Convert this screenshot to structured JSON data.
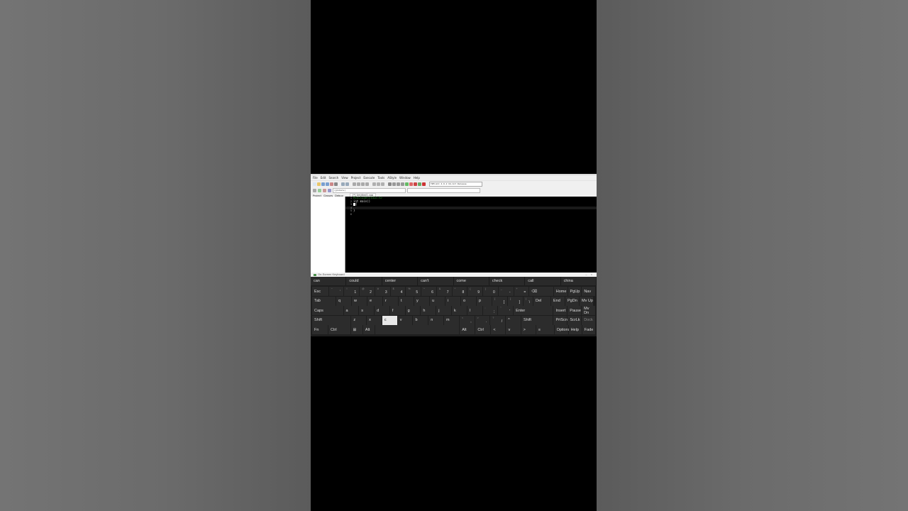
{
  "ide": {
    "menu": [
      "File",
      "Edit",
      "Search",
      "View",
      "Project",
      "Execute",
      "Tools",
      "AStyle",
      "Window",
      "Help"
    ],
    "compiler_combo": "TDM-GCC 4.9.2 64-bit Release",
    "scope_combo": "(globals)",
    "left_tabs": [
      "Project",
      "Classes",
      "Debug"
    ],
    "file_tab": "[*] Untitled1.cpp",
    "code_lines": [
      {
        "n": "1",
        "text": "#include<stdio.h>",
        "style": "comment"
      },
      {
        "n": "2",
        "text": "int main()",
        "style": "code"
      },
      {
        "n": "3",
        "text": "{",
        "style": "code"
      },
      {
        "n": "4",
        "text": "",
        "style": "code"
      },
      {
        "n": "5",
        "text": "}",
        "style": "code"
      },
      {
        "n": "6",
        "text": "",
        "style": "code"
      }
    ]
  },
  "keyboard": {
    "title": "On-Screen Keyboard",
    "suggestions": [
      "can",
      "could",
      "center",
      "can't",
      "come",
      "check",
      "call",
      "china"
    ],
    "rows": [
      [
        {
          "label": "Esc",
          "w": 23
        },
        {
          "label": "`",
          "sub": "~",
          "w": 21
        },
        {
          "label": "1",
          "sub": "!",
          "w": 21
        },
        {
          "label": "2",
          "sub": "@",
          "w": 21
        },
        {
          "label": "3",
          "sub": "#",
          "w": 21
        },
        {
          "label": "4",
          "sub": "$",
          "w": 21
        },
        {
          "label": "5",
          "sub": "%",
          "w": 21
        },
        {
          "label": "6",
          "sub": "^",
          "w": 21
        },
        {
          "label": "7",
          "sub": "&",
          "w": 21
        },
        {
          "label": "8",
          "sub": "*",
          "w": 21
        },
        {
          "label": "9",
          "sub": "(",
          "w": 21
        },
        {
          "label": "0",
          "sub": ")",
          "w": 21
        },
        {
          "label": "-",
          "sub": "_",
          "w": 21
        },
        {
          "label": "=",
          "sub": "+",
          "w": 21
        },
        {
          "label": "⌫",
          "w": 34
        },
        {
          "label": "Home",
          "w": 19
        },
        {
          "label": "PgUp",
          "w": 19
        },
        {
          "label": "Nav",
          "w": 19
        }
      ],
      [
        {
          "label": "Tab",
          "w": 33
        },
        {
          "label": "q",
          "w": 21
        },
        {
          "label": "w",
          "w": 21
        },
        {
          "label": "e",
          "w": 21
        },
        {
          "label": "r",
          "w": 21
        },
        {
          "label": "t",
          "w": 21
        },
        {
          "label": "y",
          "w": 21
        },
        {
          "label": "u",
          "w": 21
        },
        {
          "label": "i",
          "w": 21
        },
        {
          "label": "o",
          "w": 21
        },
        {
          "label": "p",
          "w": 21
        },
        {
          "label": "[",
          "sub": "{",
          "w": 21
        },
        {
          "label": "]",
          "sub": "}",
          "w": 21
        },
        {
          "label": "\\",
          "sub": "|",
          "w": 13
        },
        {
          "label": "Del",
          "w": 24
        },
        {
          "label": "End",
          "w": 19
        },
        {
          "label": "PgDn",
          "w": 19
        },
        {
          "label": "Mv Up",
          "w": 19
        }
      ],
      [
        {
          "label": "Caps",
          "w": 44
        },
        {
          "label": "a",
          "w": 21
        },
        {
          "label": "s",
          "w": 21
        },
        {
          "label": "d",
          "w": 21
        },
        {
          "label": "f",
          "w": 21
        },
        {
          "label": "g",
          "w": 21
        },
        {
          "label": "h",
          "w": 21
        },
        {
          "label": "j",
          "w": 21
        },
        {
          "label": "k",
          "w": 21
        },
        {
          "label": "l",
          "w": 21
        },
        {
          "label": ";",
          "sub": ":",
          "w": 21
        },
        {
          "label": "'",
          "sub": "\"",
          "w": 21
        },
        {
          "label": "Enter",
          "w": 56
        },
        {
          "label": "Insert",
          "w": 19
        },
        {
          "label": "Pause",
          "w": 19
        },
        {
          "label": "Mv Dn",
          "w": 19
        }
      ],
      [
        {
          "label": "Shift",
          "w": 55
        },
        {
          "label": "z",
          "w": 21
        },
        {
          "label": "x",
          "w": 21
        },
        {
          "label": "c",
          "w": 21,
          "hl": true
        },
        {
          "label": "v",
          "w": 21
        },
        {
          "label": "b",
          "w": 21
        },
        {
          "label": "n",
          "w": 21
        },
        {
          "label": "m",
          "w": 21
        },
        {
          "label": ",",
          "sub": "<",
          "w": 21
        },
        {
          "label": ".",
          "sub": ">",
          "w": 21
        },
        {
          "label": "/",
          "sub": "?",
          "w": 21
        },
        {
          "label": "^",
          "w": 21
        },
        {
          "label": "Shift",
          "w": 45
        },
        {
          "label": "PrtScn",
          "w": 19
        },
        {
          "label": "ScrLk",
          "w": 19
        },
        {
          "label": "Dock",
          "w": 19,
          "dim": true
        }
      ],
      [
        {
          "label": "Fn",
          "w": 23
        },
        {
          "label": "Ctrl",
          "w": 32
        },
        {
          "label": "⊞",
          "w": 17
        },
        {
          "label": "Alt",
          "w": 17
        },
        {
          "label": "",
          "w": 124
        },
        {
          "label": "Alt",
          "w": 22
        },
        {
          "label": "Ctrl",
          "w": 22
        },
        {
          "label": "<",
          "w": 21
        },
        {
          "label": "v",
          "w": 21
        },
        {
          "label": ">",
          "w": 21
        },
        {
          "label": "≡",
          "w": 26
        },
        {
          "label": "Options",
          "w": 19
        },
        {
          "label": "Help",
          "w": 19
        },
        {
          "label": "Fade",
          "w": 19
        }
      ]
    ]
  }
}
